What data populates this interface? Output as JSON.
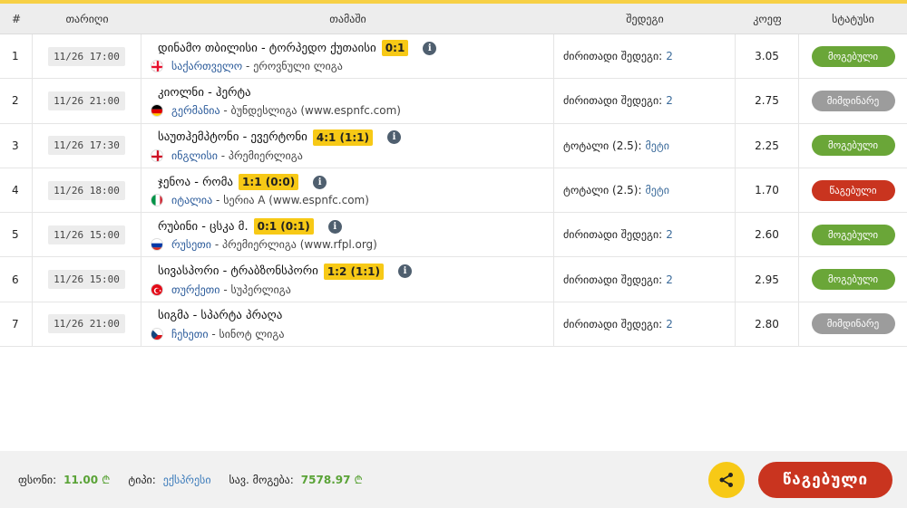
{
  "header": {
    "num": "#",
    "date": "თარიღი",
    "match": "თამაში",
    "result": "შედეგი",
    "coef": "კოეფ",
    "status": "სტატუსი"
  },
  "rows": [
    {
      "num": "1",
      "date": "11/26 17:00",
      "teams": "დინამო თბილისი - ტორპედო ქუთაისი",
      "score": "0:1",
      "has_info": true,
      "flag": "georgia",
      "country": "საქართველო",
      "league": "ეროვნული ლიგა",
      "result_label": "ძირითადი შედეგი:",
      "result_value": "2",
      "coef": "3.05",
      "status": "მოგებული",
      "status_type": "won"
    },
    {
      "num": "2",
      "date": "11/26 21:00",
      "teams": "კიოლნი - ჰერტა",
      "score": "",
      "has_info": false,
      "flag": "germany",
      "country": "გერმანია",
      "league": "ბუნდესლიგა (www.espnfc.com)",
      "result_label": "ძირითადი შედეგი:",
      "result_value": "2",
      "coef": "2.75",
      "status": "მიმდინარე",
      "status_type": "pending"
    },
    {
      "num": "3",
      "date": "11/26 17:30",
      "teams": "საუთჰემპტონი - ევერტონი",
      "score": "4:1 (1:1)",
      "has_info": true,
      "flag": "england",
      "country": "ინგლისი",
      "league": "პრემიერლიგა",
      "result_label": "ტოტალი (2.5):",
      "result_value": "მეტი",
      "coef": "2.25",
      "status": "მოგებული",
      "status_type": "won"
    },
    {
      "num": "4",
      "date": "11/26 18:00",
      "teams": "ჯენოა - რომა",
      "score": "1:1 (0:0)",
      "has_info": true,
      "flag": "italy",
      "country": "იტალია",
      "league": "სერია A (www.espnfc.com)",
      "result_label": "ტოტალი (2.5):",
      "result_value": "მეტი",
      "coef": "1.70",
      "status": "წაგებული",
      "status_type": "lost"
    },
    {
      "num": "5",
      "date": "11/26 15:00",
      "teams": "რუბინი - ცსკა მ.",
      "score": "0:1 (0:1)",
      "has_info": true,
      "flag": "russia",
      "country": "რუსეთი",
      "league": "პრემიერლიგა (www.rfpl.org)",
      "result_label": "ძირითადი შედეგი:",
      "result_value": "2",
      "coef": "2.60",
      "status": "მოგებული",
      "status_type": "won"
    },
    {
      "num": "6",
      "date": "11/26 15:00",
      "teams": "სივასპორი - ტრაბზონსპორი",
      "score": "1:2 (1:1)",
      "has_info": true,
      "flag": "turkey",
      "country": "თურქეთი",
      "league": "სუპერლიგა",
      "result_label": "ძირითადი შედეგი:",
      "result_value": "2",
      "coef": "2.95",
      "status": "მოგებული",
      "status_type": "won"
    },
    {
      "num": "7",
      "date": "11/26 21:00",
      "teams": "სიგმა - სპარტა პრაღა",
      "score": "",
      "has_info": false,
      "flag": "czech",
      "country": "ჩეხეთი",
      "league": "სინოტ ლიგა",
      "result_label": "ძირითადი შედეგი:",
      "result_value": "2",
      "coef": "2.80",
      "status": "მიმდინარე",
      "status_type": "pending"
    }
  ],
  "footer": {
    "stake_label": "ფსონი:",
    "stake_value": "11.00",
    "type_label": "ტიპი:",
    "type_value": "ექსპრესი",
    "win_label": "სავ. მოგება:",
    "win_value": "7578.97",
    "currency": "₾",
    "lost_button": "წაგებული"
  },
  "colors": {
    "accent": "#f7c916",
    "won": "#6aa638",
    "pending": "#9c9c9c",
    "lost": "#c9341f"
  },
  "icons": {
    "info": "info-icon",
    "share": "share-icon"
  }
}
